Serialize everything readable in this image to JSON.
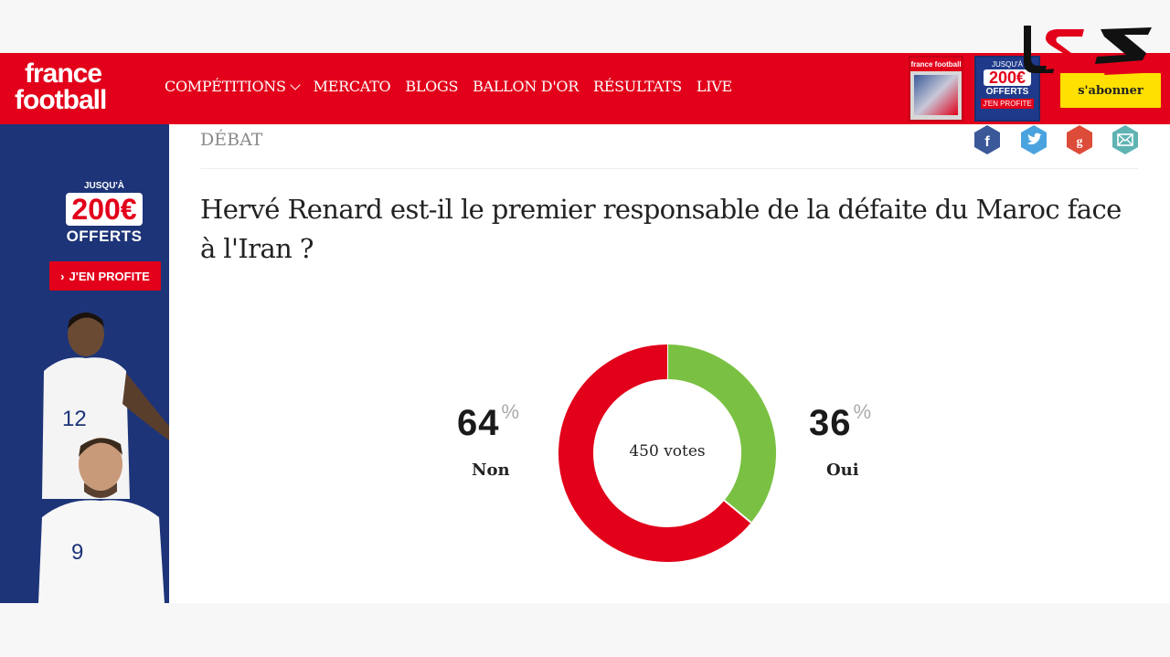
{
  "header": {
    "logo_line1": "france",
    "logo_line2": "football",
    "nav": [
      {
        "label": "COMPÉTITIONS",
        "has_dropdown": true
      },
      {
        "label": "MERCATO"
      },
      {
        "label": "BLOGS"
      },
      {
        "label": "BALLON D'OR"
      },
      {
        "label": "RÉSULTATS"
      },
      {
        "label": "LIVE"
      }
    ],
    "magazine_title": "france football",
    "promo": {
      "line1": "JUSQU'À",
      "amount": "200€",
      "line2": "OFFERTS",
      "cta": "J'EN PROFITE"
    },
    "subscribe_label": "s'abonner"
  },
  "sidebar_ad": {
    "line1": "JUSQU'À",
    "amount": "200€",
    "line2": "OFFERTS",
    "cta": "J'EN PROFITE"
  },
  "article": {
    "kicker": "DÉBAT",
    "title": "Hervé Renard est-il le premier responsable de la défaite du Maroc face à l'Iran ?",
    "share": [
      "facebook-icon",
      "twitter-icon",
      "google-plus-icon",
      "email-icon"
    ]
  },
  "poll": {
    "non_value": "64",
    "non_label": "Non",
    "oui_value": "36",
    "oui_label": "Oui",
    "percent_sign": "%",
    "votes_text": "450 votes"
  },
  "chart_data": {
    "type": "pie",
    "categories": [
      "Non",
      "Oui"
    ],
    "values": [
      64,
      36
    ],
    "colors": [
      "#e2001a",
      "#7ac143"
    ],
    "center_label": "450 votes"
  },
  "colors": {
    "brand_red": "#e2001a",
    "navy": "#1d3478",
    "yellow": "#ffe000",
    "oui_green": "#7ac143"
  }
}
